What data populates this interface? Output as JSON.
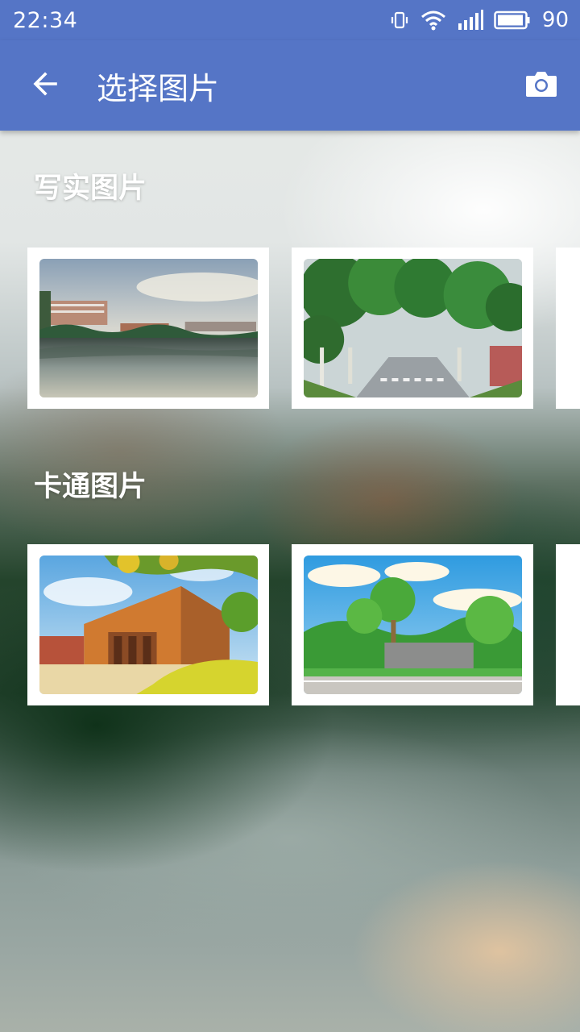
{
  "status_bar": {
    "time": "22:34",
    "battery": "90",
    "icons": [
      "vibrate-icon",
      "wifi-icon",
      "signal-icon",
      "battery-icon"
    ]
  },
  "app_bar": {
    "title": "选择图片",
    "back_icon": "arrow-back-icon",
    "camera_icon": "camera-icon"
  },
  "sections": [
    {
      "title": "写实图片",
      "items": [
        "campus-lake-photo",
        "tree-lined-road-photo"
      ]
    },
    {
      "title": "卡通图片",
      "items": [
        "cartoon-building-picture",
        "cartoon-campus-gate-picture"
      ]
    }
  ],
  "colors": {
    "app_bar": "#5575c6",
    "card_border": "#ffffff"
  }
}
